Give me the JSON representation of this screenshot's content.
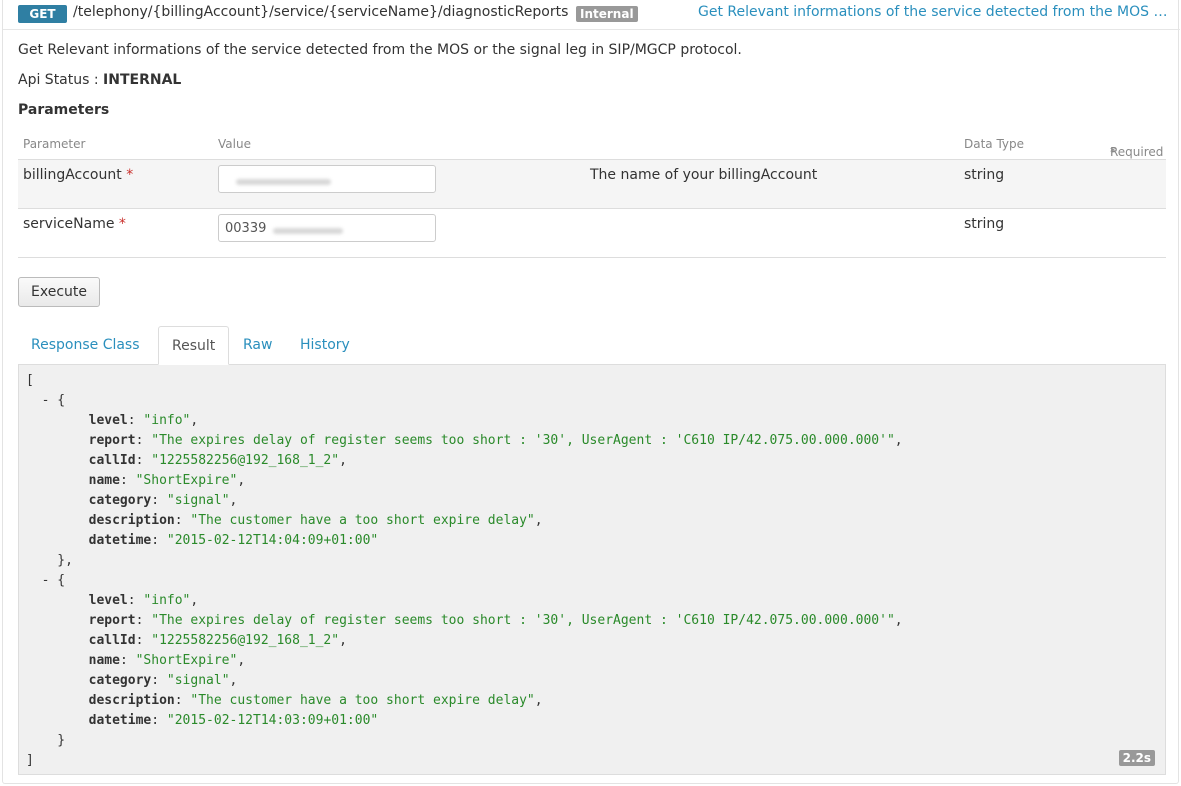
{
  "header": {
    "method": "GET",
    "path": "/telephony/{billingAccount}/service/{serviceName}/diagnosticReports",
    "badge": "Internal",
    "summary_link": "Get Relevant informations of the service detected from the MOS or..."
  },
  "description": "Get Relevant informations of the service detected from the MOS or the signal leg in SIP/MGCP protocol.",
  "api_status": {
    "label": "Api Status : ",
    "value": "INTERNAL"
  },
  "parameters": {
    "title": "Parameters",
    "headers": {
      "parameter": "Parameter",
      "value": "Value",
      "data_type": "Data Type",
      "required_note": "Required"
    },
    "rows": [
      {
        "name": "billingAccount",
        "required": "*",
        "value": "",
        "description": "The name of your billingAccount",
        "type": "string"
      },
      {
        "name": "serviceName",
        "required": "*",
        "value": "00339",
        "description": "",
        "type": "string"
      }
    ]
  },
  "execute_label": "Execute",
  "tabs": [
    {
      "label": "Response Class"
    },
    {
      "label": "Result"
    },
    {
      "label": "Raw"
    },
    {
      "label": "History"
    }
  ],
  "result": {
    "open": "[",
    "close": "]",
    "items": [
      {
        "level": "\"info\"",
        "report": "\"The expires delay of register seems too short : '30', UserAgent : 'C610 IP/42.075.00.000.000'\"",
        "callId": "\"1225582256@192_168_1_2\"",
        "name": "\"ShortExpire\"",
        "category": "\"signal\"",
        "description": "\"The customer have a too short expire delay\"",
        "datetime": "\"2015-02-12T14:04:09+01:00\""
      },
      {
        "level": "\"info\"",
        "report": "\"The expires delay of register seems too short : '30', UserAgent : 'C610 IP/42.075.00.000.000'\"",
        "callId": "\"1225582256@192_168_1_2\"",
        "name": "\"ShortExpire\"",
        "category": "\"signal\"",
        "description": "\"The customer have a too short expire delay\"",
        "datetime": "\"2015-02-12T14:03:09+01:00\""
      }
    ],
    "elapsed": "2.2s"
  }
}
